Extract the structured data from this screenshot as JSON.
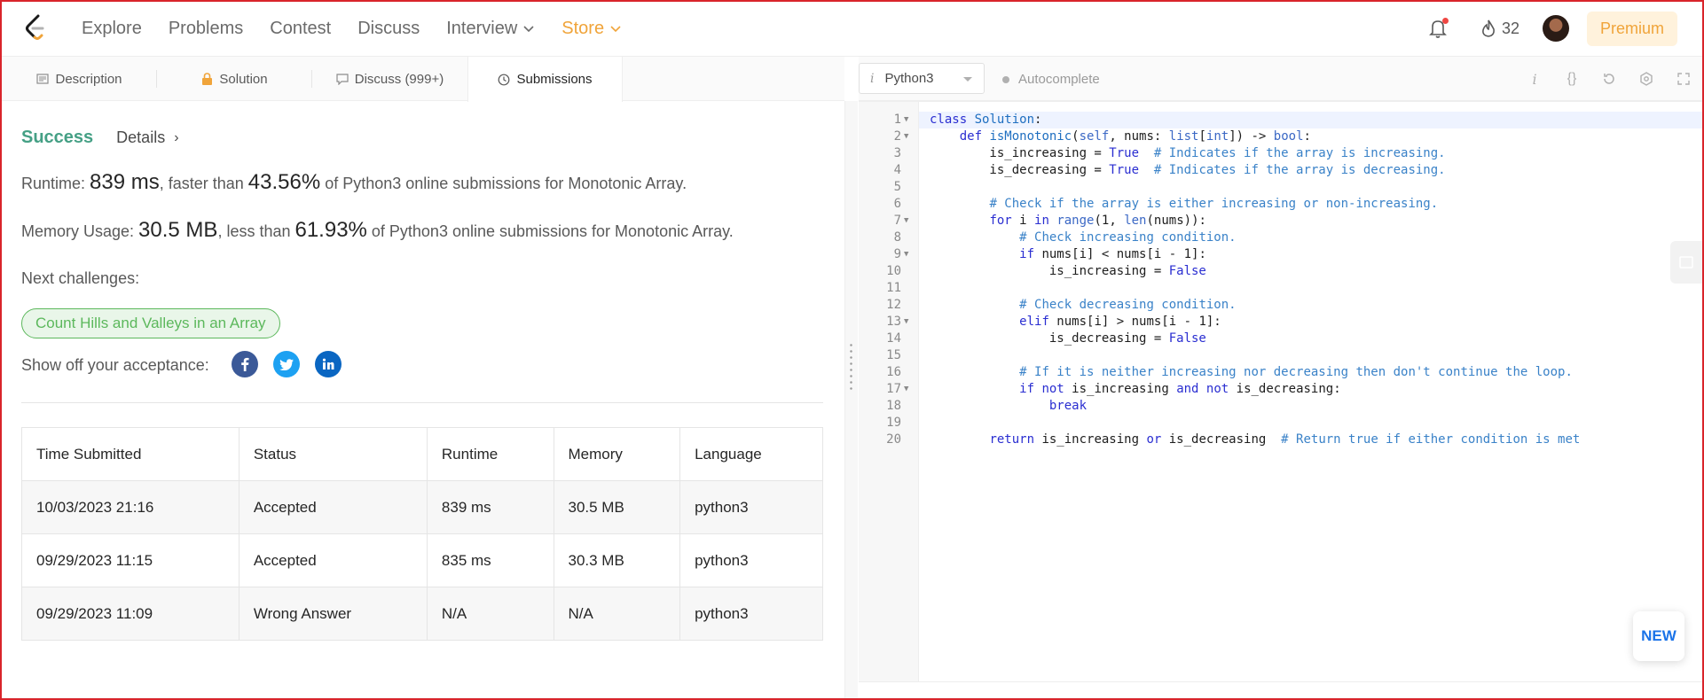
{
  "nav": {
    "links": [
      "Explore",
      "Problems",
      "Contest",
      "Discuss",
      "Interview",
      "Store"
    ],
    "streak_count": "32",
    "premium_label": "Premium"
  },
  "tabs": [
    {
      "label": "Description",
      "icon": "description-icon"
    },
    {
      "label": "Solution",
      "icon": "lock-icon"
    },
    {
      "label": "Discuss (999+)",
      "icon": "discuss-icon"
    },
    {
      "label": "Submissions",
      "icon": "clock-icon"
    }
  ],
  "result": {
    "status": "Success",
    "details_label": "Details",
    "runtime_prefix": "Runtime: ",
    "runtime_value": "839 ms",
    "runtime_mid": ", faster than ",
    "runtime_percent": "43.56%",
    "runtime_suffix": " of Python3 online submissions for Monotonic Array.",
    "memory_prefix": "Memory Usage: ",
    "memory_value": "30.5 MB",
    "memory_mid": ", less than ",
    "memory_percent": "61.93%",
    "memory_suffix": " of Python3 online submissions for Monotonic Array.",
    "next_label": "Next challenges:",
    "next_challenge": "Count Hills and Valleys in an Array",
    "share_label": "Show off your acceptance:"
  },
  "table": {
    "headers": [
      "Time Submitted",
      "Status",
      "Runtime",
      "Memory",
      "Language"
    ],
    "rows": [
      {
        "time": "10/03/2023 21:16",
        "status": "Accepted",
        "runtime": "839 ms",
        "memory": "30.5 MB",
        "language": "python3"
      },
      {
        "time": "09/29/2023 11:15",
        "status": "Accepted",
        "runtime": "835 ms",
        "memory": "30.3 MB",
        "language": "python3"
      },
      {
        "time": "09/29/2023 11:09",
        "status": "Wrong Answer",
        "runtime": "N/A",
        "memory": "N/A",
        "language": "python3"
      }
    ]
  },
  "editor": {
    "language": "Python3",
    "autocomplete_label": "Autocomplete",
    "new_label": "NEW",
    "lines": [
      "class Solution:",
      "    def isMonotonic(self, nums: list[int]) -> bool:",
      "        is_increasing = True  # Indicates if the array is increasing.",
      "        is_decreasing = True  # Indicates if the array is decreasing.",
      "",
      "        # Check if the array is either increasing or non-increasing.",
      "        for i in range(1, len(nums)):",
      "            # Check increasing condition.",
      "            if nums[i] < nums[i - 1]:",
      "                is_increasing = False",
      "",
      "            # Check decreasing condition.",
      "            elif nums[i] > nums[i - 1]:",
      "                is_decreasing = False",
      "",
      "            # If it is neither increasing nor decreasing then don't continue the loop.",
      "            if not is_increasing and not is_decreasing:",
      "                break",
      "",
      "        return is_increasing or is_decreasing  # Return true if either condition is met"
    ]
  }
}
